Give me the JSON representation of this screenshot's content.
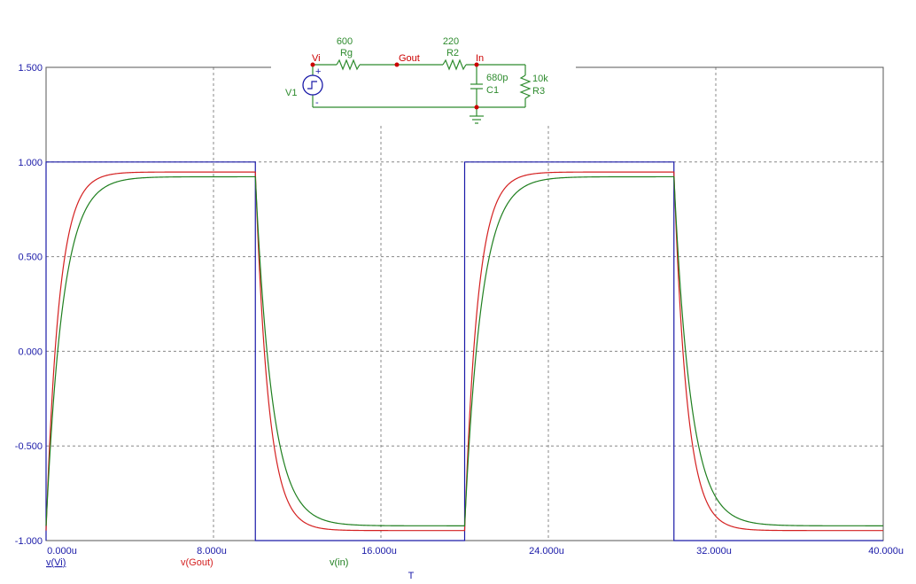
{
  "chart_data": {
    "type": "line",
    "xlabel": "T",
    "xlim": [
      0,
      40
    ],
    "ylim": [
      -1.0,
      1.5
    ],
    "x_ticks": [
      0,
      8,
      16,
      24,
      32,
      40
    ],
    "x_tick_labels": [
      "0.000u",
      "8.000u",
      "16.000u",
      "24.000u",
      "32.000u",
      "40.000u"
    ],
    "y_ticks": [
      -1.0,
      -0.5,
      0.0,
      0.5,
      1.0,
      1.5
    ],
    "y_tick_labels": [
      "-1.000",
      "-0.500",
      "0.000",
      "0.500",
      "1.000",
      "1.500"
    ],
    "grid": true,
    "legend_placement": "bottom",
    "period": 20,
    "series": [
      {
        "name": "v(Vi)",
        "color": "#1a1aa8",
        "kind": "square",
        "high": 1.0,
        "low": -1.0
      },
      {
        "name": "v(Gout)",
        "color": "#d42020",
        "kind": "rc",
        "amplitude": 0.947,
        "tau": 0.62
      },
      {
        "name": "v(in)",
        "color": "#1f7f1f",
        "kind": "rc",
        "amplitude": 0.922,
        "tau": 0.8
      }
    ]
  },
  "schematic": {
    "colors": {
      "wire": "#2e8b2e",
      "node": "#cc0000",
      "label": "#2e8b2e",
      "node_label": "#cc0000",
      "source_blue": "#1a1aa8"
    },
    "labels": {
      "rg_value": "600",
      "rg_name": "Rg",
      "r2_value": "220",
      "r2_name": "R2",
      "c1_value": "680p",
      "c1_name": "C1",
      "r3_value": "10k",
      "r3_name": "R3",
      "v1_name": "V1",
      "node_vi": "Vi",
      "node_gout": "Gout",
      "node_in": "In",
      "plus": "+",
      "minus": "-"
    }
  }
}
